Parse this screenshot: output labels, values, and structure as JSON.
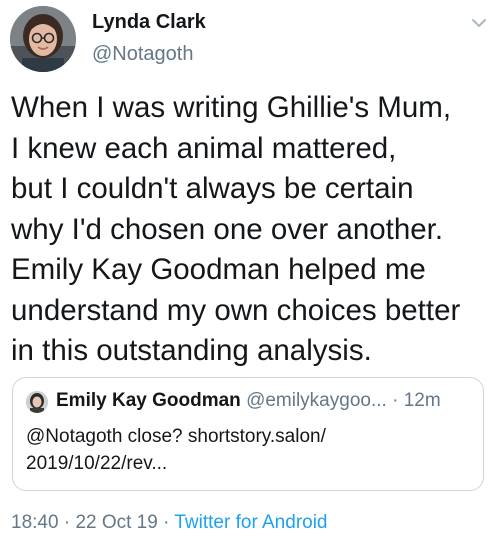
{
  "author": {
    "name": "Lynda Clark",
    "handle": "@Notagoth"
  },
  "tweet": {
    "lines": [
      "When I was writing Ghillie's Mum,",
      "I knew each animal mattered,",
      "but I couldn't always be certain",
      "why I'd chosen one over another.",
      "Emily Kay Goodman helped me",
      "understand my own choices better",
      "in this outstanding analysis."
    ]
  },
  "quoted_tweet": {
    "name": "Emily Kay Goodman",
    "handle": "@emilykaygoo...",
    "separator": "·",
    "time": "12m",
    "lines": [
      "@Notagoth close? shortstory.salon/",
      "2019/10/22/rev..."
    ]
  },
  "meta": {
    "time": "18:40",
    "separator1": "·",
    "date": "22 Oct 19",
    "separator2": "·",
    "source": "Twitter for Android"
  },
  "colors": {
    "text": "#14171a",
    "secondary": "#657786",
    "link": "#1da1f2",
    "border": "#ccd6dd"
  },
  "icons": {
    "caret": "chevron-down-icon",
    "author_avatar": "avatar",
    "quoted_avatar": "avatar"
  }
}
